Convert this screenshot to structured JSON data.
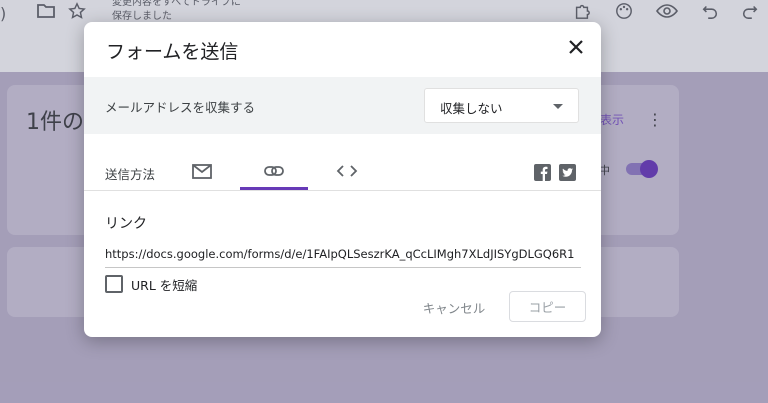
{
  "topbar": {
    "partial_text": ")",
    "status_line1": "変更内容をすべてドライブに",
    "status_line2": "保存しました"
  },
  "background": {
    "responses_title_partial": "1件の",
    "show_link_partial": "表示",
    "accepting_partial": "中"
  },
  "dialog": {
    "title": "フォームを送信",
    "collect_email_label": "メールアドレスを収集する",
    "collect_email_value": "収集しない",
    "send_method_label": "送信方法",
    "link_heading": "リンク",
    "url": "https://docs.google.com/forms/d/e/1FAIpQLSeszrKA_qCcLIMgh7XLdJISYgDLGQ6R1",
    "shorten_url_label": "URL を短縮",
    "shorten_url_checked": false,
    "cancel_label": "キャンセル",
    "copy_label": "コピー"
  },
  "colors": {
    "accent": "#673ab7",
    "scrim": "#b7b1c9"
  }
}
